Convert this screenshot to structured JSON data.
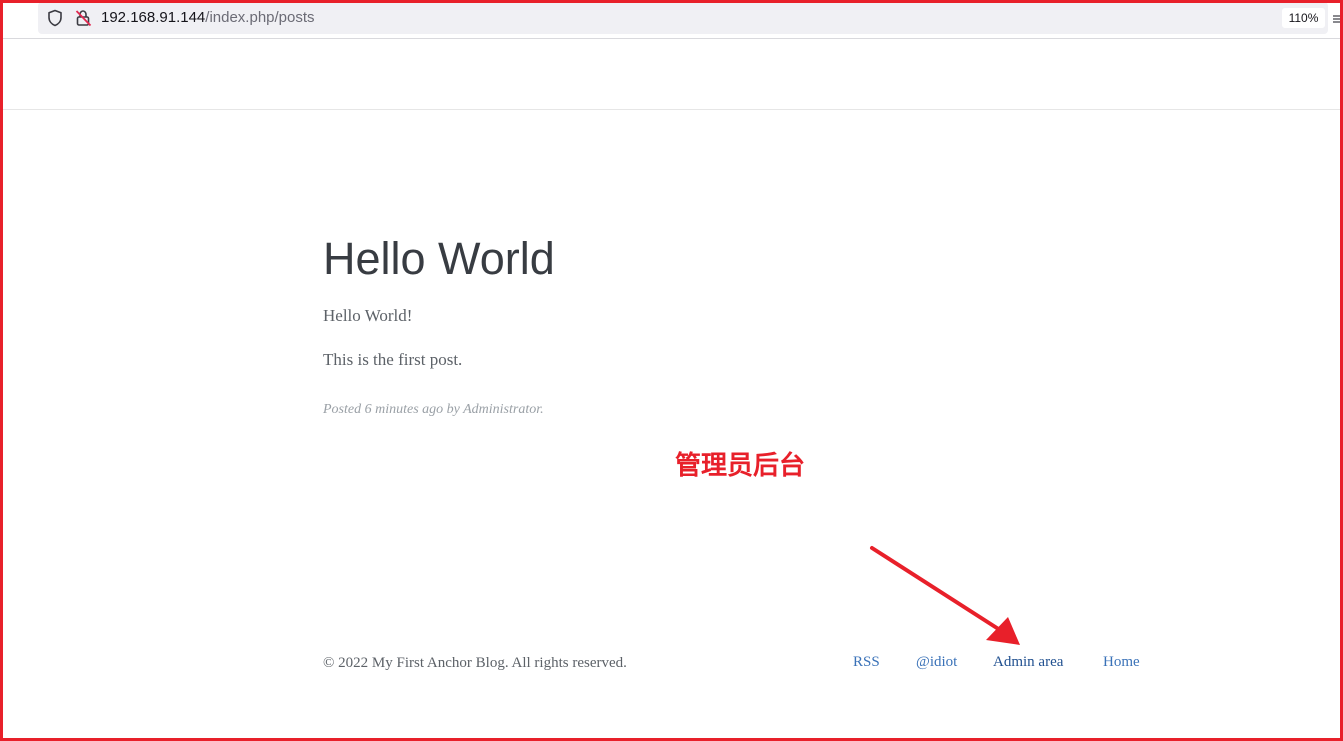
{
  "browser": {
    "url_host": "192.168.91.144",
    "url_path": "/index.php/posts",
    "zoom": "110%"
  },
  "post": {
    "title": "Hello World",
    "paragraphs": [
      "Hello World!",
      "This is the first post."
    ],
    "meta": "Posted 6 minutes ago by Administrator."
  },
  "annotation": {
    "label": "管理员后台",
    "color": "#e8202a"
  },
  "footer": {
    "copyright": "© 2022 My First Anchor Blog. All rights reserved.",
    "links": {
      "rss": "RSS",
      "twitter": "@idiot",
      "admin": "Admin area",
      "home": "Home"
    }
  },
  "icons": {
    "shield": "shield-icon",
    "insecure": "insecure-connection-icon",
    "reader": "reader-view-icon",
    "arrow": "red-arrow-icon"
  }
}
